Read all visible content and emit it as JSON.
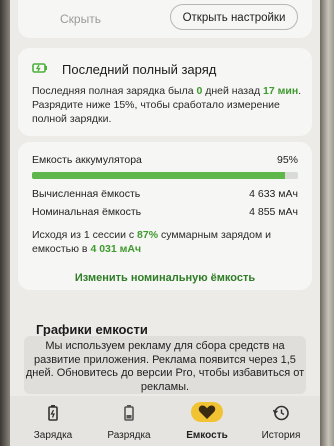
{
  "top_card": {
    "hide_label": "Скрыть",
    "open_settings_label": "Открыть настройки"
  },
  "last_full_charge": {
    "title": "Последний полный заряд",
    "text_before": "Последняя полная зарядка была ",
    "days_value": "0",
    "text_mid": " дней назад ",
    "minutes_value": "17 мин",
    "text_after": ". Разрядите ниже 15%, чтобы сработало измерение полной зарядки."
  },
  "capacity": {
    "label": "Емкость аккумулятора",
    "percent_text": "95%",
    "percent_value": 95,
    "calculated_label": "Вычисленная ёмкость",
    "calculated_value": "4 633 мАч",
    "nominal_label": "Номинальная ёмкость",
    "nominal_value": "4 855 мАч",
    "note_part1": "Исходя из 1 сессии с ",
    "note_percent": "87%",
    "note_part2": " суммарным зарядом и емкостью в ",
    "note_value": "4 031 мАч",
    "change_link": "Изменить номинальную ёмкость"
  },
  "graphs_title": "Графики емкости",
  "ad_text": "Мы используем рекламу для сбора средств на развитие приложения. Реклама появится через 1,5 дней. Обновитесь до версии Pro, чтобы избавиться от рекламы.",
  "bottom_nav": [
    {
      "label": "Зарядка",
      "icon": "charging-battery-icon"
    },
    {
      "label": "Разрядка",
      "icon": "discharging-battery-icon"
    },
    {
      "label": "Емкость",
      "icon": "heart-icon",
      "active": true
    },
    {
      "label": "История",
      "icon": "history-icon"
    }
  ],
  "colors": {
    "accent_green": "#3f9a2f",
    "bar_green": "#5fb64b",
    "active_tab": "#f1c232"
  }
}
